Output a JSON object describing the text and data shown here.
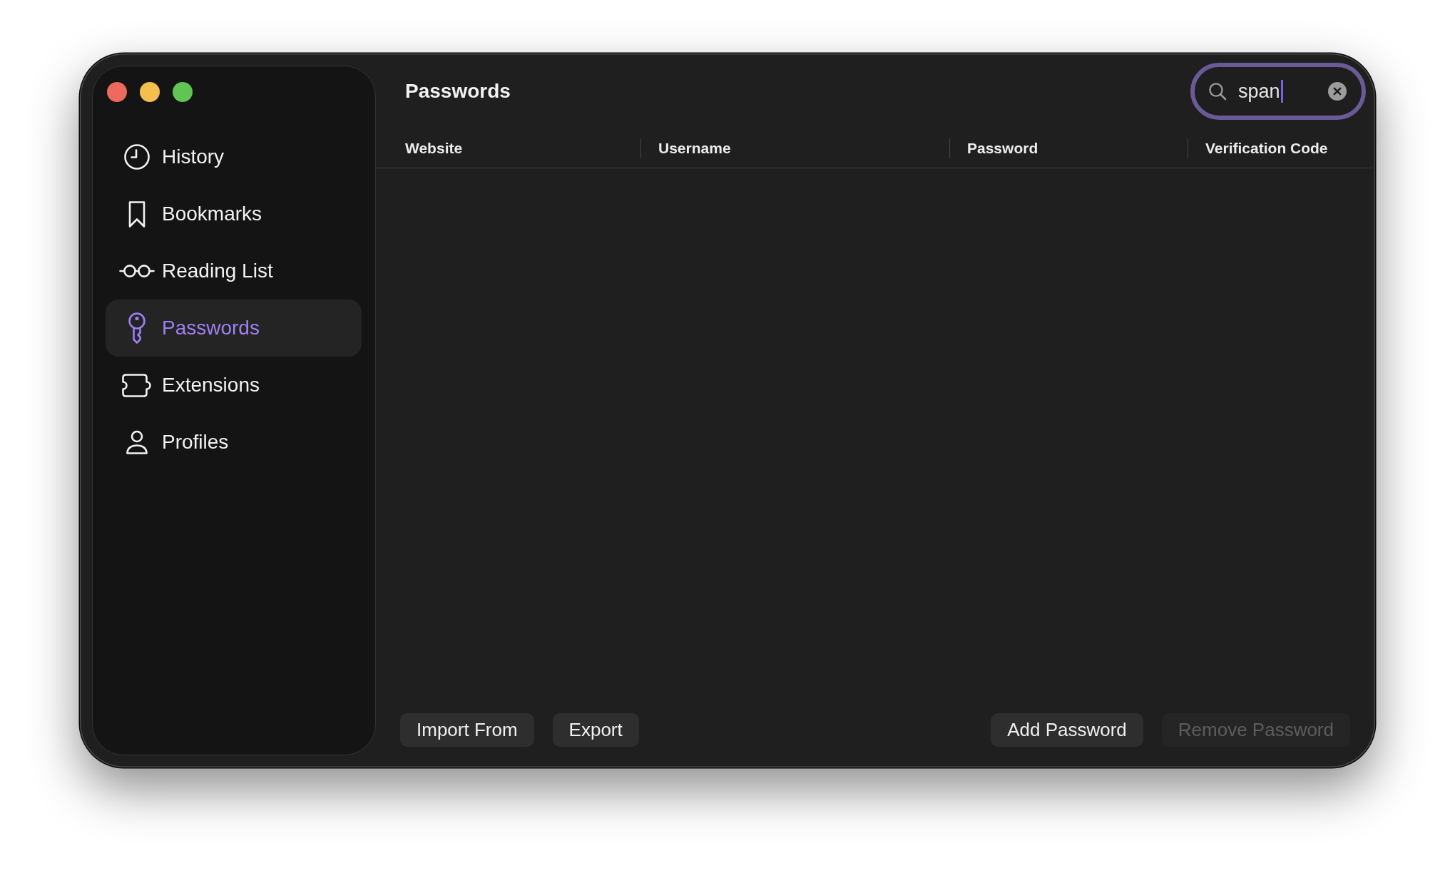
{
  "sidebar": {
    "items": [
      {
        "label": "History",
        "selected": false
      },
      {
        "label": "Bookmarks",
        "selected": false
      },
      {
        "label": "Reading List",
        "selected": false
      },
      {
        "label": "Passwords",
        "selected": true
      },
      {
        "label": "Extensions",
        "selected": false
      },
      {
        "label": "Profiles",
        "selected": false
      }
    ]
  },
  "header": {
    "title": "Passwords",
    "search": {
      "value": "span",
      "focused": true
    }
  },
  "table": {
    "columns": [
      "Website",
      "Username",
      "Password",
      "Verification Code"
    ]
  },
  "footer": {
    "left_buttons": [
      {
        "label": "Import From",
        "disabled": false
      },
      {
        "label": "Export",
        "disabled": false
      }
    ],
    "right_buttons": [
      {
        "label": "Add Password",
        "disabled": false
      },
      {
        "label": "Remove Password",
        "disabled": true
      }
    ]
  }
}
